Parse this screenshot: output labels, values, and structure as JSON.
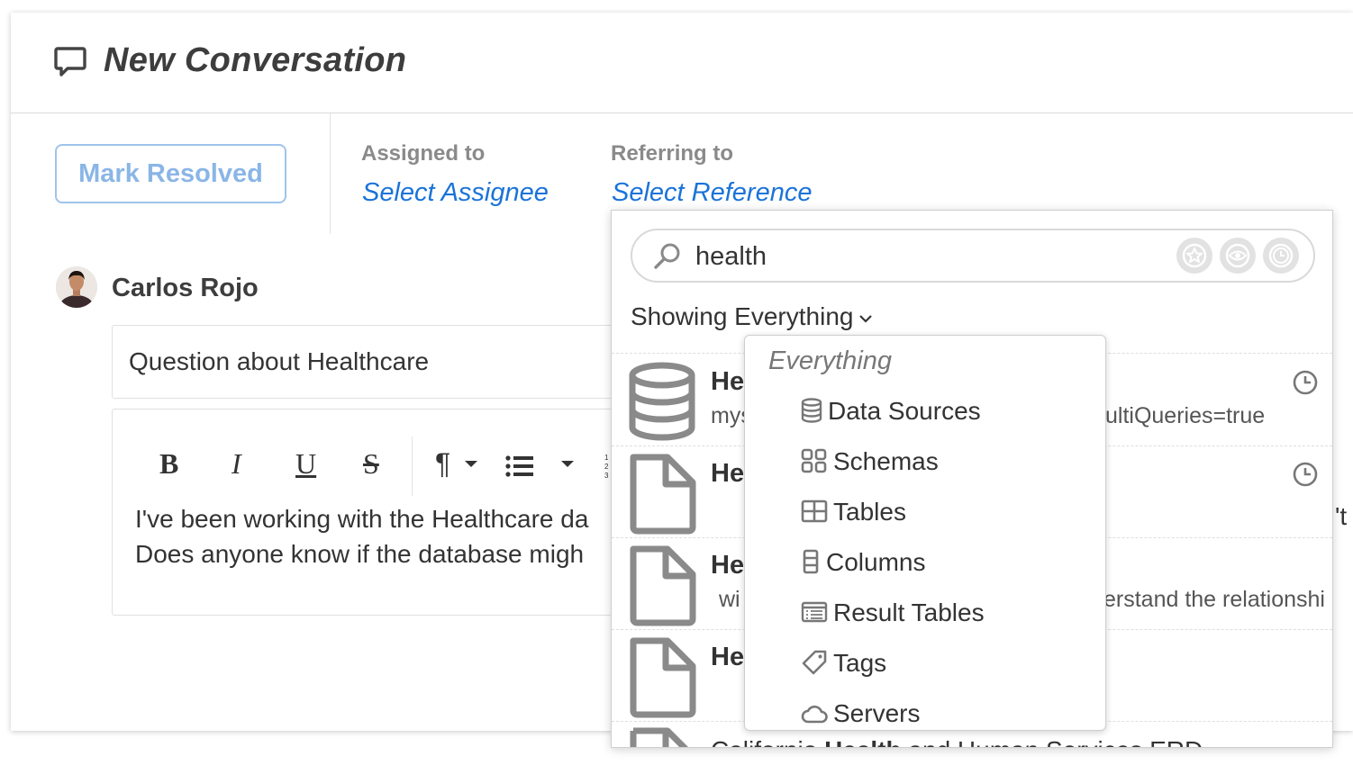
{
  "header": {
    "title": "New Conversation",
    "icon": "chat-bubble-icon"
  },
  "actions": {
    "mark_resolved_label": "Mark Resolved"
  },
  "assignment": {
    "assigned_label": "Assigned to",
    "assigned_value": "Select Assignee",
    "referring_label": "Referring to",
    "referring_value": "Select Reference"
  },
  "post": {
    "author": "Carlos Rojo",
    "subject": "Question about Healthcare",
    "body_line1": "I've been working with the Healthcare da",
    "body_line2": "Does anyone know if the database migh",
    "body_line1_tail": "'t"
  },
  "toolbar": {
    "bold": "B",
    "italic": "I",
    "underline": "U",
    "strike": "S",
    "paragraph": "¶"
  },
  "reference_search": {
    "query": "health",
    "filter_icons": [
      "star-icon",
      "eye-icon",
      "clock-icon"
    ],
    "showing_label": "Showing Everything",
    "results": [
      {
        "title": "He",
        "subtitle": "mys",
        "subtitle_tail": "ultiQueries=true",
        "icon": "database-icon",
        "recent": true
      },
      {
        "title": "He",
        "subtitle": "",
        "subtitle_tail": "",
        "icon": "document-icon",
        "recent": true
      },
      {
        "title": "He",
        "subtitle": "wi",
        "subtitle_tail": "erstand the relationshi",
        "icon": "document-icon",
        "recent": false
      },
      {
        "title": "He",
        "subtitle": "",
        "subtitle_tail": "",
        "icon": "document-icon",
        "recent": false
      }
    ],
    "last_result_pre": "California ",
    "last_result_bold": "Health",
    "last_result_post": " and Human Services ERD"
  },
  "type_menu": {
    "all_label": "Everything",
    "items": [
      {
        "label": "Data Sources",
        "icon": "database-icon"
      },
      {
        "label": "Schemas",
        "icon": "schema-icon"
      },
      {
        "label": "Tables",
        "icon": "table-icon"
      },
      {
        "label": "Columns",
        "icon": "column-icon"
      },
      {
        "label": "Result Tables",
        "icon": "result-table-icon"
      },
      {
        "label": "Tags",
        "icon": "tag-icon"
      },
      {
        "label": "Servers",
        "icon": "cloud-icon"
      }
    ]
  },
  "colors": {
    "accent": "#1a73d9",
    "resolved_border": "#9fc4ec",
    "resolved_text": "#8ab6e6",
    "icon_gray": "#8a8a8a"
  }
}
